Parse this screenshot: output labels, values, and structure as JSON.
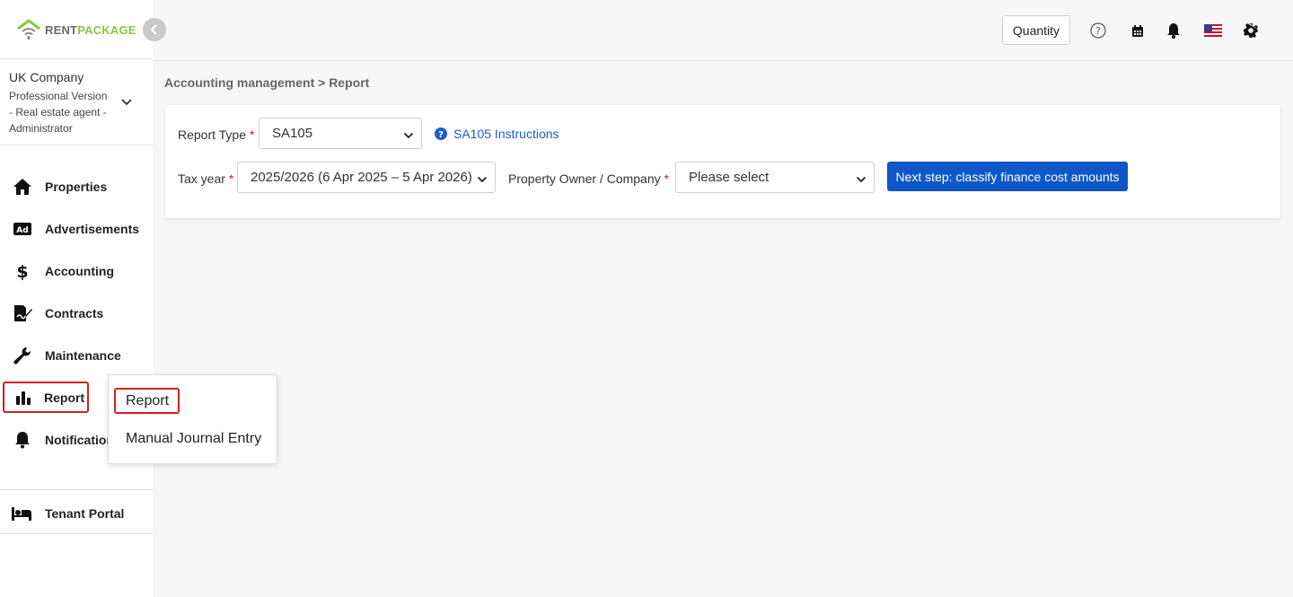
{
  "brand": {
    "rent": "RENT",
    "package": "PACKAGE"
  },
  "company": {
    "name": "UK Company",
    "detail": "Professional Version - Real estate agent - Administrator"
  },
  "sidebar": {
    "items": [
      {
        "label": "Properties",
        "icon": "home-icon"
      },
      {
        "label": "Advertisements",
        "icon": "ad-icon"
      },
      {
        "label": "Accounting",
        "icon": "dollar-icon"
      },
      {
        "label": "Contracts",
        "icon": "contract-icon"
      },
      {
        "label": "Maintenance",
        "icon": "wrench-icon"
      },
      {
        "label": "Report",
        "icon": "bar-chart-icon"
      },
      {
        "label": "Notifications",
        "icon": "bell-icon"
      }
    ],
    "tenant_portal": "Tenant Portal"
  },
  "topbar": {
    "quantity_label": "Quantity"
  },
  "breadcrumb": "Accounting management > Report",
  "form": {
    "report_type_label": "Report Type",
    "report_type_value": "SA105",
    "instructions_link": "SA105 Instructions",
    "tax_year_label": "Tax year",
    "tax_year_value": "2025/2026 (6 Apr 2025 – 5 Apr 2026)",
    "owner_label": "Property Owner / Company",
    "owner_value": "Please select",
    "required_mark": "*",
    "next_button": "Next step: classify finance cost amounts"
  },
  "popup": {
    "items": [
      "Report",
      "Manual Journal Entry"
    ]
  },
  "colors": {
    "accent": "#0d57c8",
    "brand_green": "#8cc63f",
    "highlight_red": "#d32020"
  }
}
